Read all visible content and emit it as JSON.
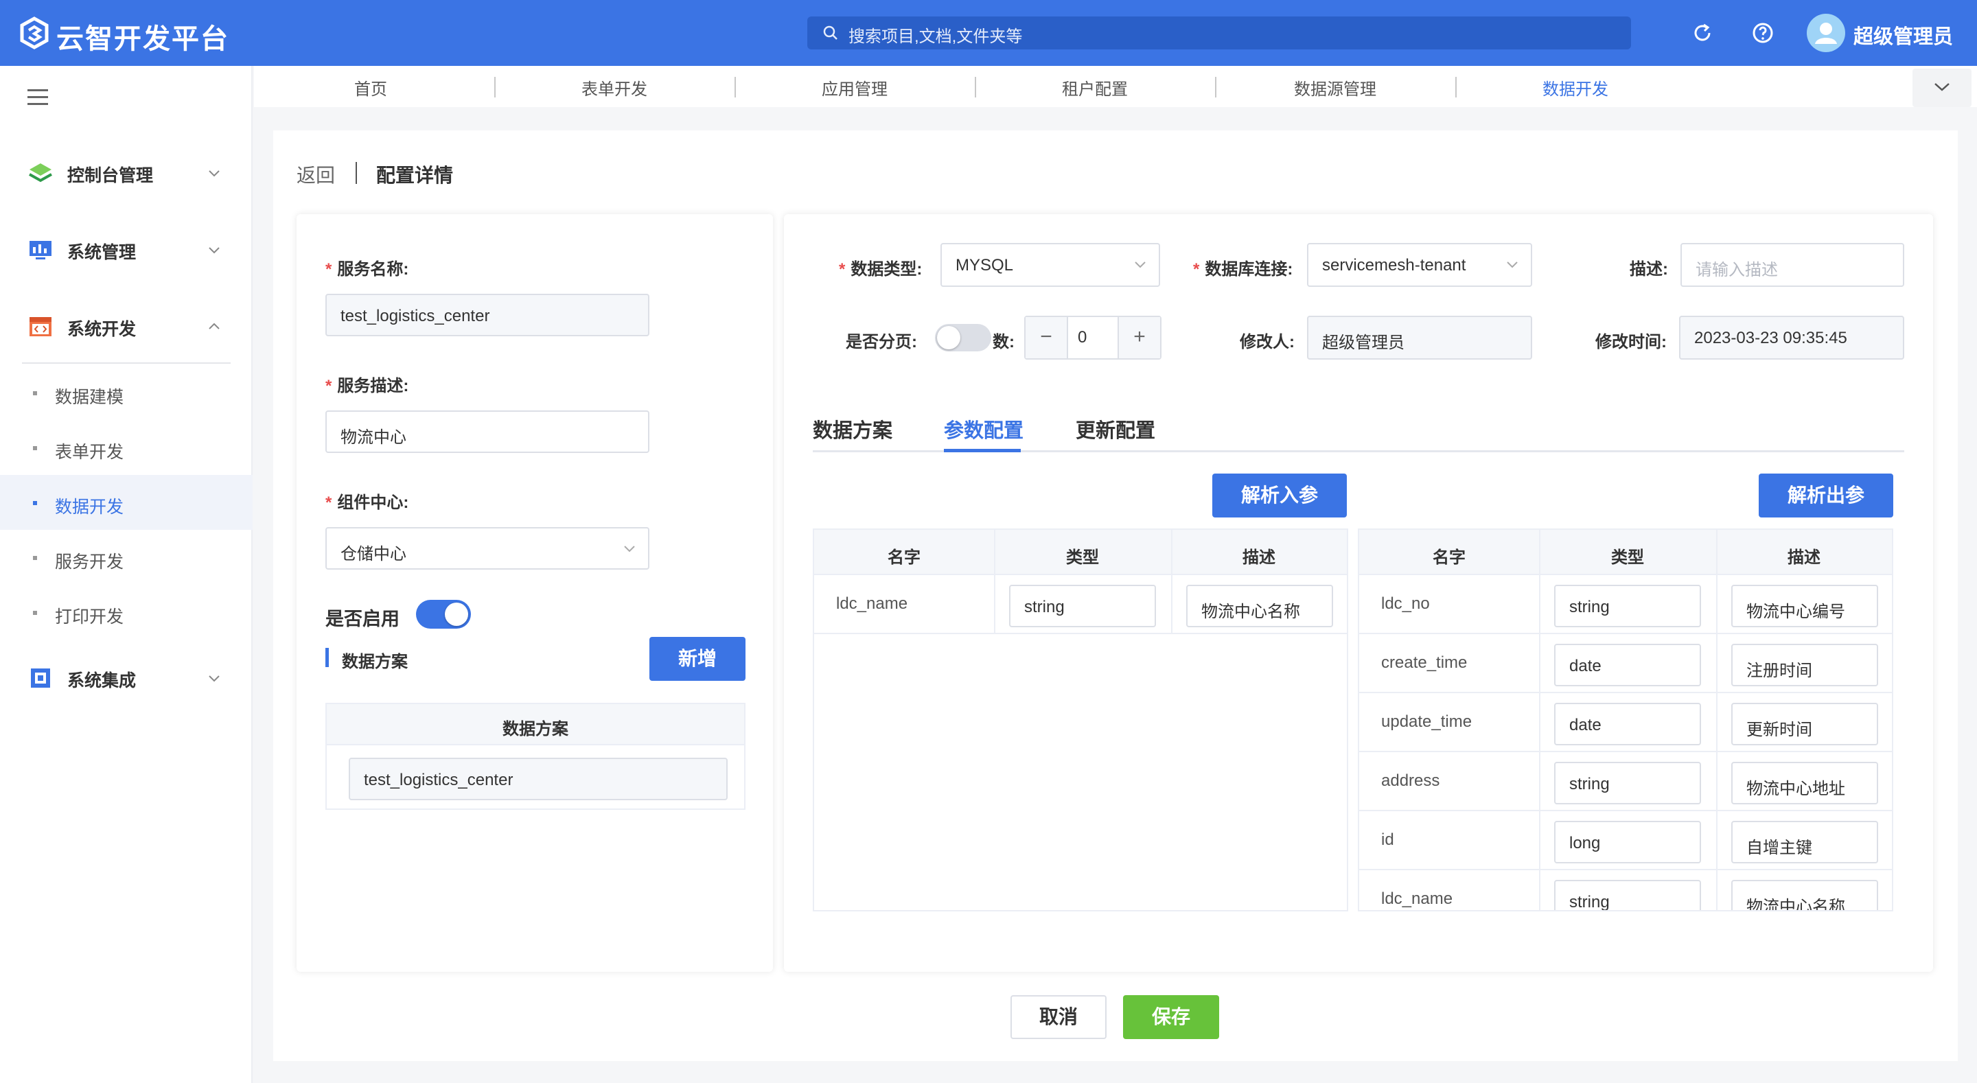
{
  "header": {
    "app_title": "云智开发平台",
    "search_placeholder": "搜索项目,文档,文件夹等",
    "user_name": "超级管理员"
  },
  "sidebar": {
    "groups": [
      {
        "label": "控制台管理"
      },
      {
        "label": "系统管理"
      },
      {
        "label": "系统开发"
      },
      {
        "label": "系统集成"
      }
    ],
    "sub_items": [
      {
        "label": "数据建模"
      },
      {
        "label": "表单开发"
      },
      {
        "label": "数据开发"
      },
      {
        "label": "服务开发"
      },
      {
        "label": "打印开发"
      }
    ],
    "active_sub": "数据开发"
  },
  "nav_tabs": [
    {
      "label": "首页"
    },
    {
      "label": "表单开发"
    },
    {
      "label": "应用管理"
    },
    {
      "label": "租户配置"
    },
    {
      "label": "数据源管理"
    },
    {
      "label": "数据开发"
    }
  ],
  "active_nav_tab": "数据开发",
  "breadcrumb": {
    "back": "返回",
    "title": "配置详情"
  },
  "left_form": {
    "service_name_label": "服务名称:",
    "service_name": "test_logistics_center",
    "service_desc_label": "服务描述:",
    "service_desc": "物流中心",
    "component_center_label": "组件中心:",
    "component_center": "仓储中心",
    "enabled_label": "是否启用",
    "enabled": true,
    "scheme_section": "数据方案",
    "add_button": "新增",
    "scheme_table": {
      "header": "数据方案",
      "rows": [
        "test_logistics_center"
      ]
    }
  },
  "right_form": {
    "data_type_label": "数据类型:",
    "data_type": "MYSQL",
    "db_conn_label": "数据库连接:",
    "db_conn": "servicemesh-tenant",
    "desc_label": "描述:",
    "desc_placeholder": "请输入描述",
    "paging_label": "是否分页:",
    "paging_enabled": false,
    "count_label": "数:",
    "count_value": "0",
    "minus": "−",
    "plus": "+",
    "modifier_label": "修改人:",
    "modifier": "超级管理员",
    "modified_time_label": "修改时间:",
    "modified_time": "2023-03-23 09:35:45"
  },
  "param_tabs": [
    {
      "label": "数据方案"
    },
    {
      "label": "参数配置"
    },
    {
      "label": "更新配置"
    }
  ],
  "active_param_tab": "参数配置",
  "parse_in_button": "解析入参",
  "parse_out_button": "解析出参",
  "columns": {
    "name": "名字",
    "type": "类型",
    "desc": "描述"
  },
  "input_params": [
    {
      "name": "ldc_name",
      "type": "string",
      "desc": "物流中心名称"
    }
  ],
  "output_params": [
    {
      "name": "ldc_no",
      "type": "string",
      "desc": "物流中心编号"
    },
    {
      "name": "create_time",
      "type": "date",
      "desc": "注册时间"
    },
    {
      "name": "update_time",
      "type": "date",
      "desc": "更新时间"
    },
    {
      "name": "address",
      "type": "string",
      "desc": "物流中心地址"
    },
    {
      "name": "id",
      "type": "long",
      "desc": "自增主键"
    },
    {
      "name": "ldc_name",
      "type": "string",
      "desc": "物流中心名称"
    }
  ],
  "footer": {
    "cancel": "取消",
    "save": "保存"
  },
  "colors": {
    "primary": "#3b74e4",
    "save": "#67c23a",
    "required": "#e84d4d"
  }
}
